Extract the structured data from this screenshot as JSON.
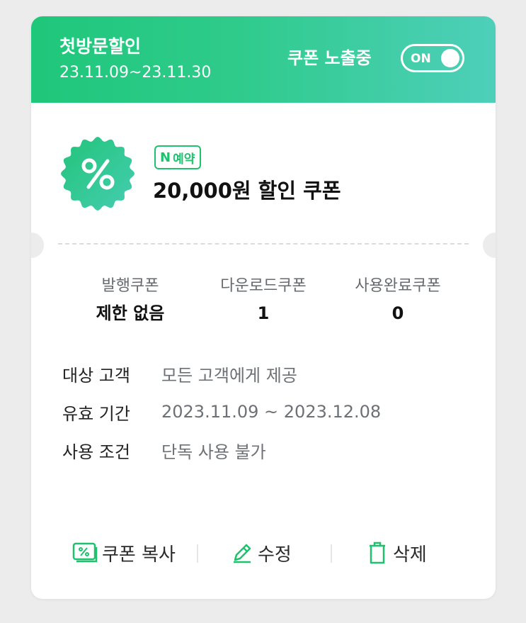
{
  "header": {
    "title": "첫방문할인",
    "period": "23.11.09~23.11.30",
    "exposure_label": "쿠폰 노출중",
    "toggle_label": "ON"
  },
  "coupon": {
    "badge_n": "N",
    "badge_text": "예약",
    "name": "20,000원 할인 쿠폰",
    "icon": "percent-icon"
  },
  "stats": [
    {
      "label": "발행쿠폰",
      "value": "제한 없음"
    },
    {
      "label": "다운로드쿠폰",
      "value": "1"
    },
    {
      "label": "사용완료쿠폰",
      "value": "0"
    }
  ],
  "details": [
    {
      "key": "대상 고객",
      "value": "모든 고객에게 제공"
    },
    {
      "key": "유효 기간",
      "value": "2023.11.09 ~ 2023.12.08"
    },
    {
      "key": "사용 조건",
      "value": "단독 사용 불가"
    }
  ],
  "actions": {
    "copy_label": "쿠폰 복사",
    "edit_label": "수정",
    "delete_label": "삭제"
  },
  "colors": {
    "accent": "#1ec26e",
    "header_gradient_start": "#1fc77a",
    "header_gradient_end": "#4ecfba"
  }
}
